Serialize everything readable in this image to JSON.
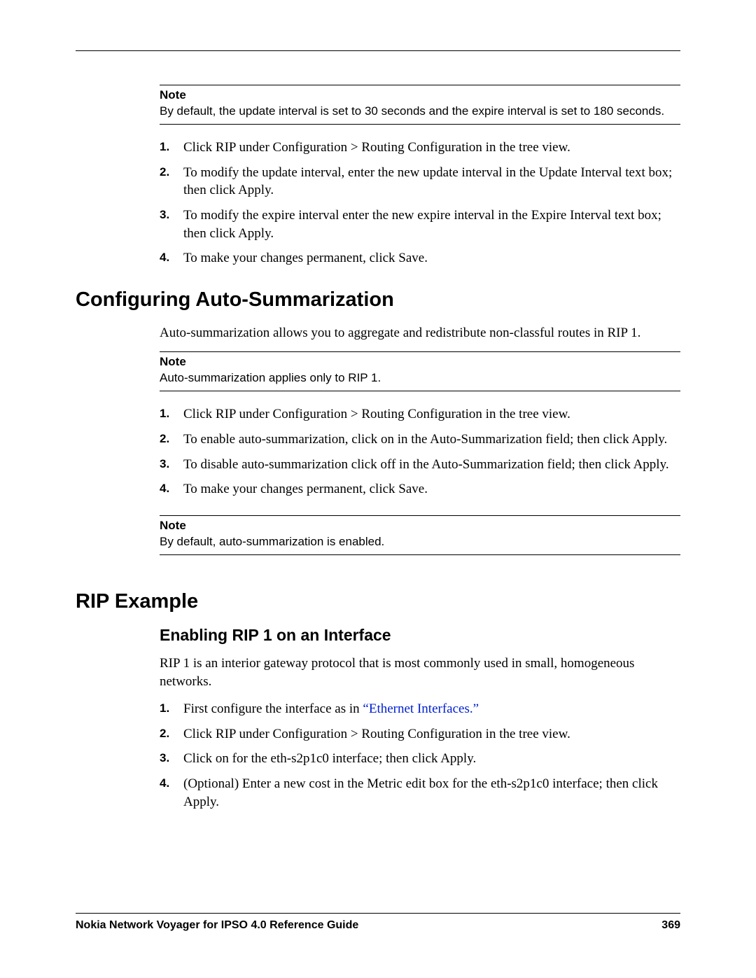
{
  "note1": {
    "label": "Note",
    "text": "By default, the update interval is set to 30 seconds and the expire interval is set to 180 seconds."
  },
  "steps1": [
    "Click RIP under Configuration > Routing Configuration in the tree view.",
    "To modify the update interval, enter the new update interval in the Update Interval text box; then click Apply.",
    "To modify the expire interval enter the new expire interval in the Expire Interval text box; then click Apply.",
    "To make your changes permanent, click Save."
  ],
  "section1": {
    "title": "Configuring Auto-Summarization",
    "intro": "Auto-summarization allows you to aggregate and redistribute non-classful routes in RIP 1."
  },
  "note2": {
    "label": "Note",
    "text": "Auto-summarization applies only to RIP 1."
  },
  "steps2": [
    "Click RIP under Configuration > Routing Configuration in the tree view.",
    "To enable auto-summarization, click on in the Auto-Summarization field; then click Apply.",
    "To disable auto-summarization click off in the Auto-Summarization field; then click Apply.",
    "To make your changes permanent, click Save."
  ],
  "note3": {
    "label": "Note",
    "text": "By default, auto-summarization is enabled."
  },
  "section2": {
    "title": "RIP Example"
  },
  "subsection1": {
    "title": "Enabling RIP 1 on an Interface",
    "intro": "RIP 1 is an interior gateway protocol that is most commonly used in small, homogeneous networks."
  },
  "steps3_prefix": "First configure the interface as in ",
  "steps3_link": "“Ethernet Interfaces.”",
  "steps3_rest": [
    "Click RIP under Configuration > Routing Configuration in the tree view.",
    "Click on for the eth-s2p1c0 interface; then click Apply.",
    "(Optional) Enter a new cost in the Metric edit box for the eth-s2p1c0 interface; then click Apply."
  ],
  "footer": {
    "title": "Nokia Network Voyager for IPSO 4.0 Reference Guide",
    "page": "369"
  },
  "nums": {
    "n1": "1.",
    "n2": "2.",
    "n3": "3.",
    "n4": "4."
  }
}
